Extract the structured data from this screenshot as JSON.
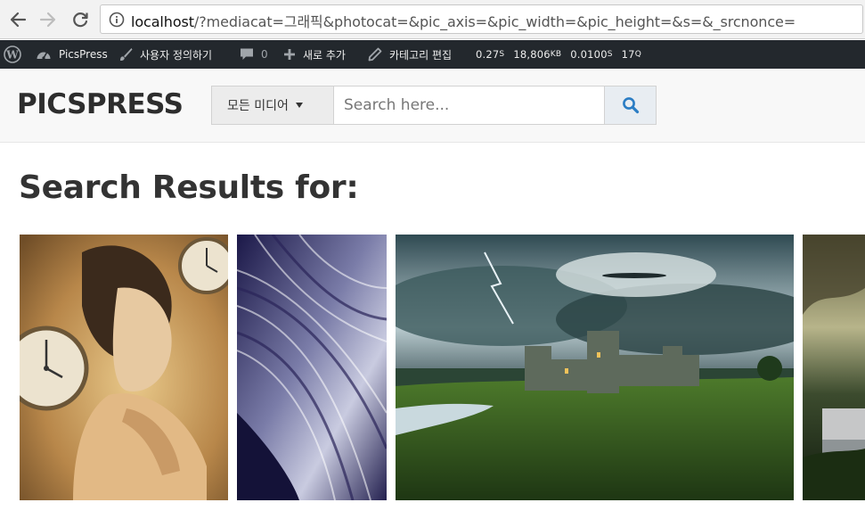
{
  "browser": {
    "url_host": "localhost",
    "url_rest": "/?mediacat=그래픽&photocat=&pic_axis=&pic_width=&pic_height=&s=&_srcnonce="
  },
  "adminbar": {
    "site_name": "PicsPress",
    "customize": "사용자 정의하기",
    "comments_count": "0",
    "new_label": "새로 추가",
    "edit_label": "카테고리 편집",
    "stat_time": "0.27",
    "stat_time_unit": "S",
    "stat_memory": "18,806",
    "stat_memory_unit": "KB",
    "stat_query_time": "0.0100",
    "stat_query_time_unit": "S",
    "stat_queries": "17",
    "stat_queries_unit": "Q"
  },
  "header": {
    "logo": "PICSPRESS",
    "category_selected": "모든 미디어",
    "search_placeholder": "Search here..."
  },
  "main": {
    "title": "Search Results for:",
    "thumbnails": [
      {
        "icon": "woman-clocks-art"
      },
      {
        "icon": "fractal-art"
      },
      {
        "icon": "castle-storm-art"
      },
      {
        "icon": "bridge-art"
      }
    ]
  },
  "colors": {
    "adminbar_bg": "#23282d",
    "header_bg": "#f8f8f8",
    "search_btn_icon": "#2b7dc4"
  }
}
